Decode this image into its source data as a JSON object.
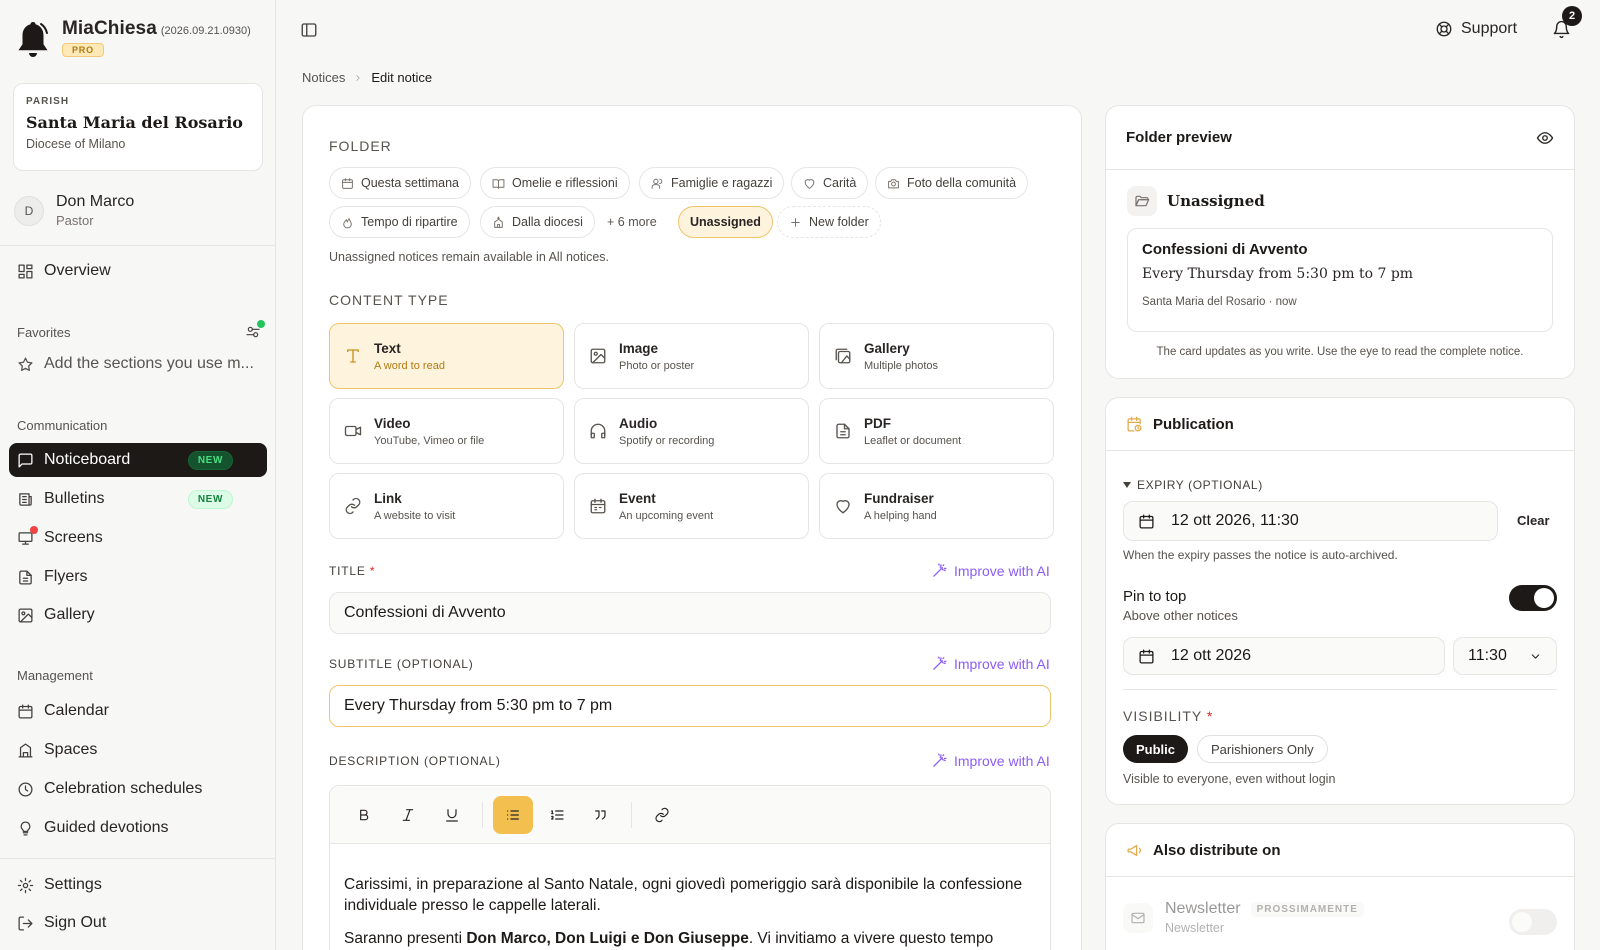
{
  "app": {
    "name": "MiaChiesa",
    "version": "(2026.09.21.0930)",
    "plan": "PRO"
  },
  "parish": {
    "kicker": "PARISH",
    "name": "Santa Maria del Rosario",
    "diocese": "Diocese of Milano"
  },
  "user": {
    "initial": "D",
    "name": "Don Marco",
    "role": "Pastor"
  },
  "sidebar": {
    "overview": "Overview",
    "favorites_title": "Favorites",
    "favorites_add": "Add the sections you use m...",
    "communication_title": "Communication",
    "communication": [
      {
        "label": "Noticeboard",
        "badge": "NEW",
        "active": true
      },
      {
        "label": "Bulletins",
        "badge": "NEW"
      },
      {
        "label": "Screens",
        "dot": true
      },
      {
        "label": "Flyers"
      },
      {
        "label": "Gallery"
      }
    ],
    "management_title": "Management",
    "management": [
      {
        "label": "Calendar"
      },
      {
        "label": "Spaces"
      },
      {
        "label": "Celebration schedules"
      },
      {
        "label": "Guided devotions"
      }
    ],
    "settings": "Settings",
    "sign_out": "Sign Out"
  },
  "topbar": {
    "support": "Support",
    "notifications_count": "2"
  },
  "breadcrumb": {
    "parent": "Notices",
    "current": "Edit notice"
  },
  "folder": {
    "label": "FOLDER",
    "chips": [
      "Questa settimana",
      "Omelie e riflessioni",
      "Famiglie e ragazzi",
      "Carità",
      "Foto della comunità",
      "Tempo di ripartire",
      "Dalla diocesi"
    ],
    "more": "+ 6 more",
    "selected": "Unassigned",
    "new_folder": "New folder",
    "help": "Unassigned notices remain available in All notices."
  },
  "content_type": {
    "label": "CONTENT TYPE",
    "items": [
      {
        "title": "Text",
        "sub": "A word to read",
        "icon": "text-icon",
        "selected": true
      },
      {
        "title": "Image",
        "sub": "Photo or poster",
        "icon": "image-icon"
      },
      {
        "title": "Gallery",
        "sub": "Multiple photos",
        "icon": "gallery-icon"
      },
      {
        "title": "Video",
        "sub": "YouTube, Vimeo or file",
        "icon": "video-icon"
      },
      {
        "title": "Audio",
        "sub": "Spotify or recording",
        "icon": "headphones-icon"
      },
      {
        "title": "PDF",
        "sub": "Leaflet or document",
        "icon": "document-icon"
      },
      {
        "title": "Link",
        "sub": "A website to visit",
        "icon": "link-icon"
      },
      {
        "title": "Event",
        "sub": "An upcoming event",
        "icon": "calendar-icon"
      },
      {
        "title": "Fundraiser",
        "sub": "A helping hand",
        "icon": "heart-icon"
      }
    ]
  },
  "form": {
    "title_label": "TITLE",
    "title_value": "Confessioni di Avvento",
    "subtitle_label": "SUBTITLE (OPTIONAL)",
    "subtitle_value": "Every Thursday from 5:30 pm to 7 pm",
    "description_label": "DESCRIPTION (OPTIONAL)",
    "improve_ai": "Improve with AI",
    "description_p1": "Carissimi, in preparazione al Santo Natale, ogni giovedì pomeriggio sarà disponibile la confessione individuale presso le cappelle laterali.",
    "description_p2_start": "Saranno presenti ",
    "description_p2_bold": "Don Marco, Don Luigi e Don Giuseppe",
    "description_p2_end": ". Vi invitiamo a vivere questo tempo"
  },
  "folder_preview": {
    "title": "Folder preview",
    "folder_name": "Unassigned",
    "card_title": "Confessioni di Avvento",
    "card_subtitle": "Every Thursday from 5:30 pm to 7 pm",
    "card_meta": "Santa Maria del Rosario · now",
    "note": "The card updates as you write. Use the eye to read the complete notice."
  },
  "publication": {
    "title": "Publication",
    "expiry_label": "EXPIRY (OPTIONAL)",
    "expiry_value": "12 ott 2026, 11:30",
    "clear": "Clear",
    "expiry_help": "When the expiry passes the notice is auto-archived.",
    "pin_title": "Pin to top",
    "pin_sub": "Above other notices",
    "pin_on": true,
    "pin_date": "12 ott 2026",
    "pin_time": "11:30",
    "visibility_label": "VISIBILITY",
    "visibility_options": [
      "Public",
      "Parishioners Only"
    ],
    "visibility_selected": "Public",
    "visibility_help": "Visible to everyone, even without login"
  },
  "distribute": {
    "title": "Also distribute on",
    "channel": "Newsletter",
    "channel_badge": "PROSSIMAMENTE",
    "channel_sub": "Newsletter",
    "channel_on": false
  },
  "colors": {
    "accent": "#f3c04f",
    "accent_bg": "#fef4dd",
    "ai": "#8b5cf6",
    "dark": "#1c1917"
  }
}
